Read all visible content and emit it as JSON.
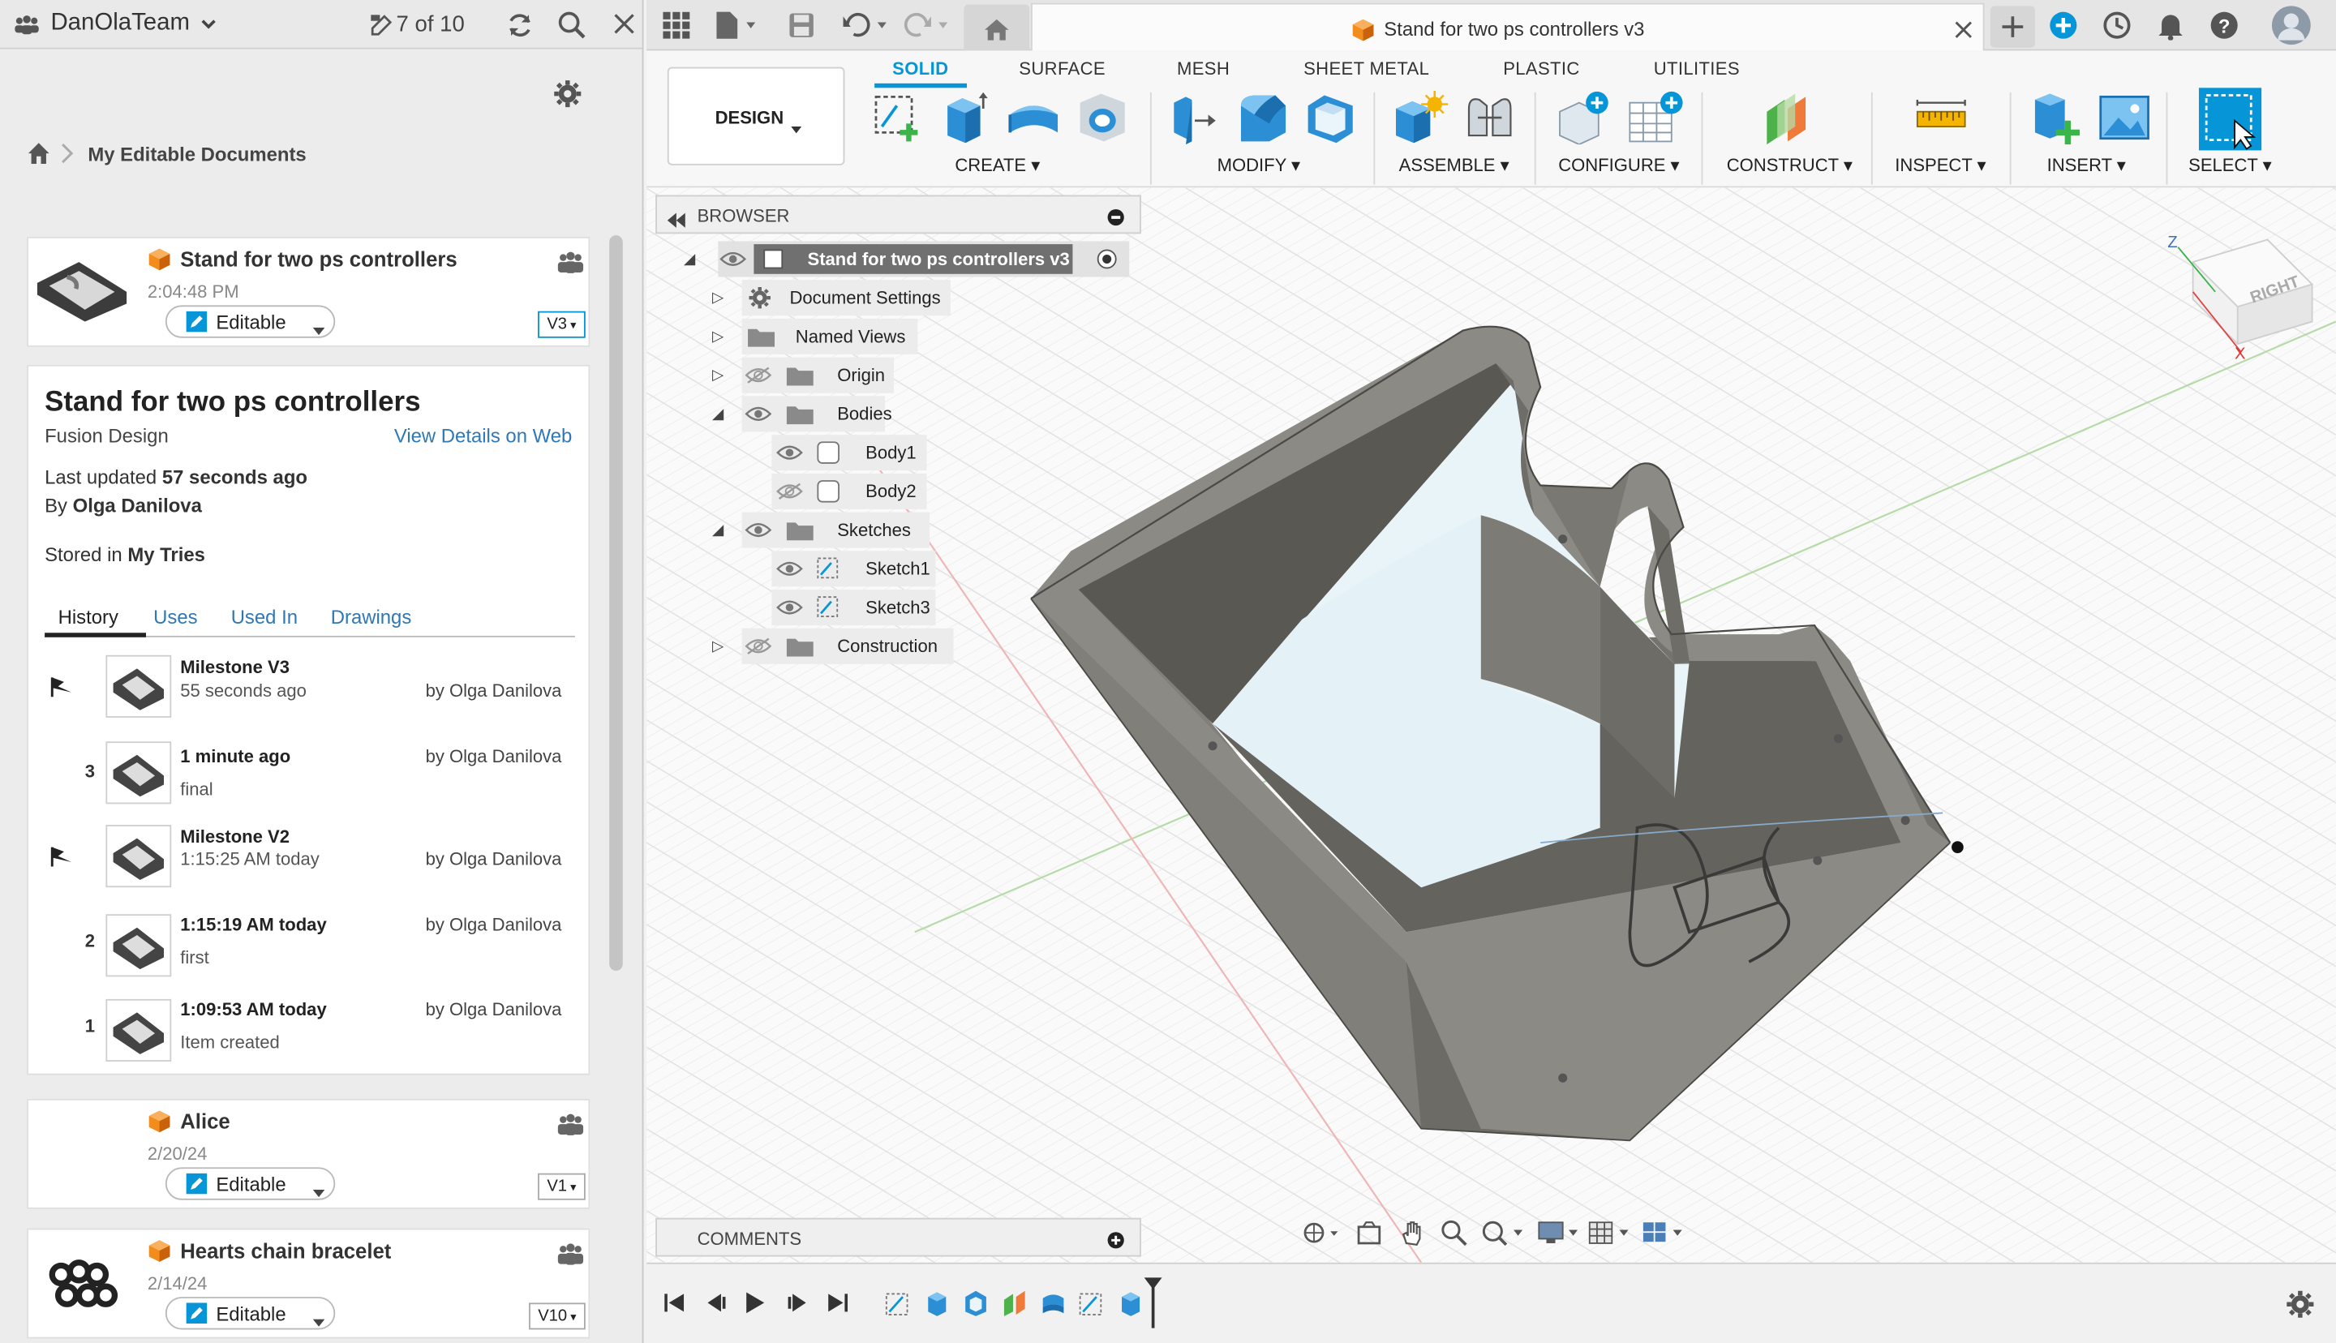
{
  "colors": {
    "accent": "#0696d7",
    "body_gray": "#7f7e79",
    "brand_orange": "#f28c1c"
  },
  "left_panel": {
    "team_name": "DanOlaTeam",
    "doc_count": "7 of 10",
    "breadcrumb": "My Editable Documents",
    "files": [
      {
        "name": "Stand for two ps controllers",
        "date": "2:04:48 PM",
        "status": "Editable",
        "version": "V3"
      },
      {
        "name": "Alice",
        "date": "2/20/24",
        "status": "Editable",
        "version": "V1"
      },
      {
        "name": "Hearts chain bracelet",
        "date": "2/14/24",
        "status": "Editable",
        "version": "V10"
      }
    ],
    "details": {
      "title": "Stand for two ps controllers",
      "type": "Fusion Design",
      "view_link": "View Details on Web",
      "updated_label": "Last updated",
      "updated_value": "57 seconds ago",
      "by_label": "By",
      "by_value": "Olga Danilova",
      "stored_label": "Stored in",
      "stored_value": "My Tries",
      "tabs": [
        "History",
        "Uses",
        "Used In",
        "Drawings"
      ],
      "history": [
        {
          "title": "Milestone V3",
          "sub": "55 seconds ago",
          "by": "by Olga Danilova",
          "num": "",
          "milestone": true
        },
        {
          "title": "1 minute ago",
          "sub": "final",
          "by": "by Olga Danilova",
          "num": "3",
          "milestone": false
        },
        {
          "title": "Milestone V2",
          "sub": "1:15:25 AM today",
          "by": "by Olga Danilova",
          "num": "",
          "milestone": true
        },
        {
          "title": "1:15:19 AM today",
          "sub": "first",
          "by": "by Olga Danilova",
          "num": "2",
          "milestone": false
        },
        {
          "title": "1:09:53 AM today",
          "sub": "Item created",
          "by": "by Olga Danilova",
          "num": "1",
          "milestone": false
        }
      ]
    }
  },
  "document_tab": {
    "title": "Stand for two ps controllers v3"
  },
  "ribbon": {
    "workspace": "DESIGN",
    "tabs": [
      "SOLID",
      "SURFACE",
      "MESH",
      "SHEET METAL",
      "PLASTIC",
      "UTILITIES"
    ],
    "groups": [
      "CREATE",
      "MODIFY",
      "ASSEMBLE",
      "CONFIGURE",
      "CONSTRUCT",
      "INSPECT",
      "INSERT",
      "SELECT"
    ]
  },
  "browser": {
    "title": "BROWSER",
    "root": "Stand for two ps controllers v3",
    "nodes": [
      "Document Settings",
      "Named Views",
      "Origin",
      "Bodies",
      "Body1",
      "Body2",
      "Sketches",
      "Sketch1",
      "Sketch3",
      "Construction"
    ]
  },
  "comments_label": "COMMENTS",
  "viewcube": {
    "face": "RIGHT",
    "axis_z": "Z",
    "axis_x": "X"
  }
}
